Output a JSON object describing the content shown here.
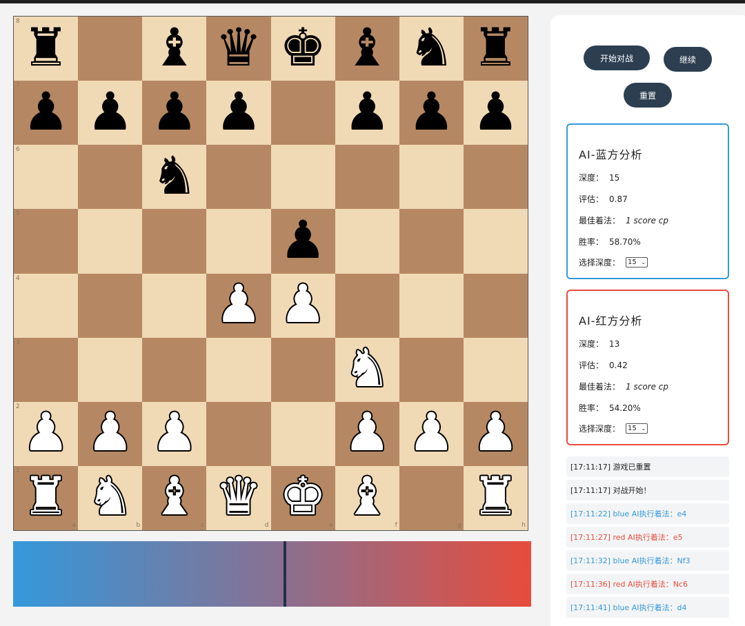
{
  "board": {
    "ranks": [
      "8",
      "7",
      "6",
      "5",
      "4",
      "3",
      "2",
      "1"
    ],
    "files": [
      "a",
      "b",
      "c",
      "d",
      "e",
      "f",
      "g",
      "h"
    ],
    "rows": [
      [
        "r",
        "",
        "b",
        "q",
        "k",
        "b",
        "n",
        "r"
      ],
      [
        "p",
        "p",
        "p",
        "p",
        "",
        "p",
        "p",
        "p"
      ],
      [
        "",
        "",
        "n",
        "",
        "",
        "",
        "",
        ""
      ],
      [
        "",
        "",
        "",
        "",
        "p",
        "",
        "",
        ""
      ],
      [
        "",
        "",
        "",
        "P",
        "P",
        "",
        "",
        ""
      ],
      [
        "",
        "",
        "",
        "",
        "",
        "N",
        "",
        ""
      ],
      [
        "P",
        "P",
        "P",
        "",
        "",
        "P",
        "P",
        "P"
      ],
      [
        "R",
        "N",
        "B",
        "Q",
        "K",
        "B",
        "",
        "R"
      ]
    ],
    "light_color": "#f0d9b5",
    "dark_color": "#b58863"
  },
  "eval_bar": {
    "blue_color": "#3498db",
    "red_color": "#e74c3c",
    "marker_position": 0.52
  },
  "controls": {
    "start_label": "开始对战",
    "continue_label": "继续",
    "reset_label": "重置",
    "button_color": "#2c3e50"
  },
  "ai_blue": {
    "title": "AI-蓝方分析",
    "depth_label": "深度：",
    "depth": "15",
    "eval_label": "评估：",
    "eval": "0.87",
    "best_label": "最佳着法：",
    "best": "1 score cp",
    "winrate_label": "胜率：",
    "winrate": "58.70%",
    "select_label": "选择深度：",
    "select_value": "15",
    "border_color": "#3498db"
  },
  "ai_red": {
    "title": "AI-红方分析",
    "depth_label": "深度：",
    "depth": "13",
    "eval_label": "评估：",
    "eval": "0.42",
    "best_label": "最佳着法：",
    "best": "1 score cp",
    "winrate_label": "胜率：",
    "winrate": "54.20%",
    "select_label": "选择深度：",
    "select_value": "15",
    "border_color": "#e74c3c"
  },
  "log": [
    {
      "text": "[17:11:17] 游戏已重置",
      "kind": "sys"
    },
    {
      "text": "[17:11:17] 对战开始！",
      "kind": "sys"
    },
    {
      "text": "[17:11:22] blue AI执行着法：e4",
      "kind": "blue"
    },
    {
      "text": "[17:11:27] red AI执行着法：e5",
      "kind": "red"
    },
    {
      "text": "[17:11:32] blue AI执行着法：Nf3",
      "kind": "blue"
    },
    {
      "text": "[17:11:36] red AI执行着法：Nc6",
      "kind": "red"
    },
    {
      "text": "[17:11:41] blue AI执行着法：d4",
      "kind": "blue"
    }
  ]
}
